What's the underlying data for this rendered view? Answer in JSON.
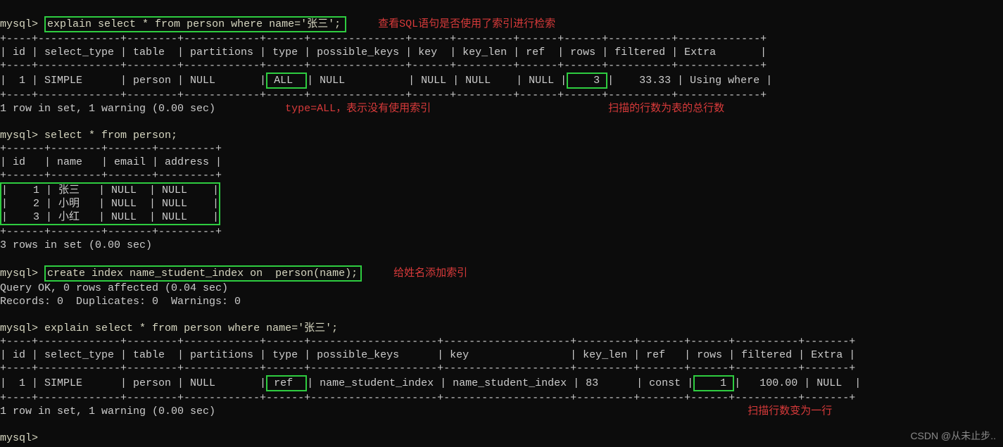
{
  "prompt": "mysql>",
  "cmd1": "explain select * from person where name='张三';",
  "anno1": "查看SQL语句是否使用了索引进行检索",
  "t1_border": "+----+-------------+--------+------------+------+---------------+------+---------+------+------+----------+-------------+",
  "t1_head": "| id | select_type | table  | partitions | type | possible_keys | key  | key_len | ref  | rows | filtered | Extra       |",
  "t1_row_pre": "|  1 | SIMPLE      | person | NULL       |",
  "t1_type": " ALL  ",
  "t1_row_mid": "| NULL          | NULL | NULL    | NULL |",
  "t1_rows": "    3 ",
  "t1_row_post": "|    33.33 | Using where |",
  "anno2": "type=ALL，表示没有使用索引",
  "anno3": "扫描的行数为表的总行数",
  "rowset1": "1 row in set, 1 warning (0.00 sec)",
  "cmd2": "select * from person;",
  "t2_border": "+------+--------+-------+---------+",
  "t2_head": "| id   | name   | email | address |",
  "t2_r1": "|    1 | 张三   | NULL  | NULL    |",
  "t2_r2": "|    2 | 小明   | NULL  | NULL    |",
  "t2_r3": "|    3 | 小红   | NULL  | NULL    |",
  "rowset2": "3 rows in set (0.00 sec)",
  "cmd3": "create index name_student_index on  person(name);",
  "anno4": "给姓名添加索引",
  "q_ok": "Query OK, 0 rows affected (0.04 sec)",
  "q_rec": "Records: 0  Duplicates: 0  Warnings: 0",
  "cmd4": "explain select * from person where name='张三';",
  "t3_border": "+----+-------------+--------+------------+------+--------------------+--------------------+---------+-------+------+----------+-------+",
  "t3_head": "| id | select_type | table  | partitions | type | possible_keys      | key                | key_len | ref   | rows | filtered | Extra |",
  "t3_row_pre": "|  1 | SIMPLE      | person | NULL       |",
  "t3_type": " ref  ",
  "t3_row_mid": "| name_student_index | name_student_index | 83      | const |",
  "t3_rows": "    1 ",
  "t3_row_post": "|   100.00 | NULL  |",
  "rowset3": "1 row in set, 1 warning (0.00 sec)",
  "anno5": "扫描行数变为一行",
  "watermark": "CSDN @从未止步..",
  "chart_data": {
    "type": "table",
    "tables": [
      {
        "title": "explain before index",
        "columns": [
          "id",
          "select_type",
          "table",
          "partitions",
          "type",
          "possible_keys",
          "key",
          "key_len",
          "ref",
          "rows",
          "filtered",
          "Extra"
        ],
        "rows": [
          [
            "1",
            "SIMPLE",
            "person",
            "NULL",
            "ALL",
            "NULL",
            "NULL",
            "NULL",
            "NULL",
            "3",
            "33.33",
            "Using where"
          ]
        ]
      },
      {
        "title": "person rows",
        "columns": [
          "id",
          "name",
          "email",
          "address"
        ],
        "rows": [
          [
            "1",
            "张三",
            "NULL",
            "NULL"
          ],
          [
            "2",
            "小明",
            "NULL",
            "NULL"
          ],
          [
            "3",
            "小红",
            "NULL",
            "NULL"
          ]
        ]
      },
      {
        "title": "explain after index",
        "columns": [
          "id",
          "select_type",
          "table",
          "partitions",
          "type",
          "possible_keys",
          "key",
          "key_len",
          "ref",
          "rows",
          "filtered",
          "Extra"
        ],
        "rows": [
          [
            "1",
            "SIMPLE",
            "person",
            "NULL",
            "ref",
            "name_student_index",
            "name_student_index",
            "83",
            "const",
            "1",
            "100.00",
            "NULL"
          ]
        ]
      }
    ]
  }
}
